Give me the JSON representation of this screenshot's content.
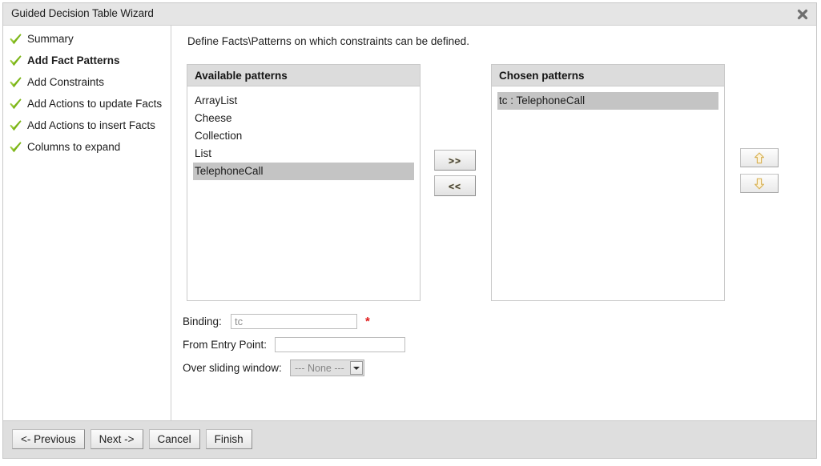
{
  "window": {
    "title": "Guided Decision Table Wizard",
    "close_icon": "close-icon"
  },
  "sidebar": {
    "steps": [
      {
        "label": "Summary",
        "icon": "check-icon",
        "current": false
      },
      {
        "label": "Add Fact Patterns",
        "icon": "check-icon",
        "current": true
      },
      {
        "label": "Add Constraints",
        "icon": "check-icon",
        "current": false
      },
      {
        "label": "Add Actions to update Facts",
        "icon": "check-icon",
        "current": false
      },
      {
        "label": "Add Actions to insert Facts",
        "icon": "check-icon",
        "current": false
      },
      {
        "label": "Columns to expand",
        "icon": "check-icon",
        "current": false
      }
    ]
  },
  "main": {
    "instruction": "Define Facts\\Patterns on which constraints can be defined.",
    "available": {
      "header": "Available patterns",
      "items": [
        {
          "label": "ArrayList",
          "selected": false
        },
        {
          "label": "Cheese",
          "selected": false
        },
        {
          "label": "Collection",
          "selected": false
        },
        {
          "label": "List",
          "selected": false
        },
        {
          "label": "TelephoneCall",
          "selected": true
        }
      ]
    },
    "chosen": {
      "header": "Chosen patterns",
      "items": [
        {
          "label": "tc : TelephoneCall",
          "selected": true
        }
      ]
    },
    "transfer": {
      "add_label": ">>",
      "remove_label": "<<"
    },
    "reorder": {
      "up_icon": "arrow-up-icon",
      "down_icon": "arrow-down-icon"
    },
    "form": {
      "binding": {
        "label": "Binding:",
        "value": "",
        "placeholder": "tc",
        "required_marker": "*"
      },
      "entry_point": {
        "label": "From Entry Point:",
        "value": "",
        "placeholder": ""
      },
      "sliding_window": {
        "label": "Over sliding window:",
        "selected": "--- None ---",
        "options": [
          "--- None ---"
        ]
      }
    }
  },
  "footer": {
    "buttons": [
      {
        "label": "<- Previous",
        "name": "previous-button"
      },
      {
        "label": "Next ->",
        "name": "next-button"
      },
      {
        "label": "Cancel",
        "name": "cancel-button"
      },
      {
        "label": "Finish",
        "name": "finish-button"
      }
    ]
  },
  "colors": {
    "titlebar_bg": "#e5e5e5",
    "footer_bg": "#dedede",
    "list_header_bg": "#dcdcdc",
    "selection_bg": "#c4c4c4",
    "check_green": "#7cb518",
    "required_red": "#e01b1b",
    "arrow_gold": "#d9b45b"
  }
}
